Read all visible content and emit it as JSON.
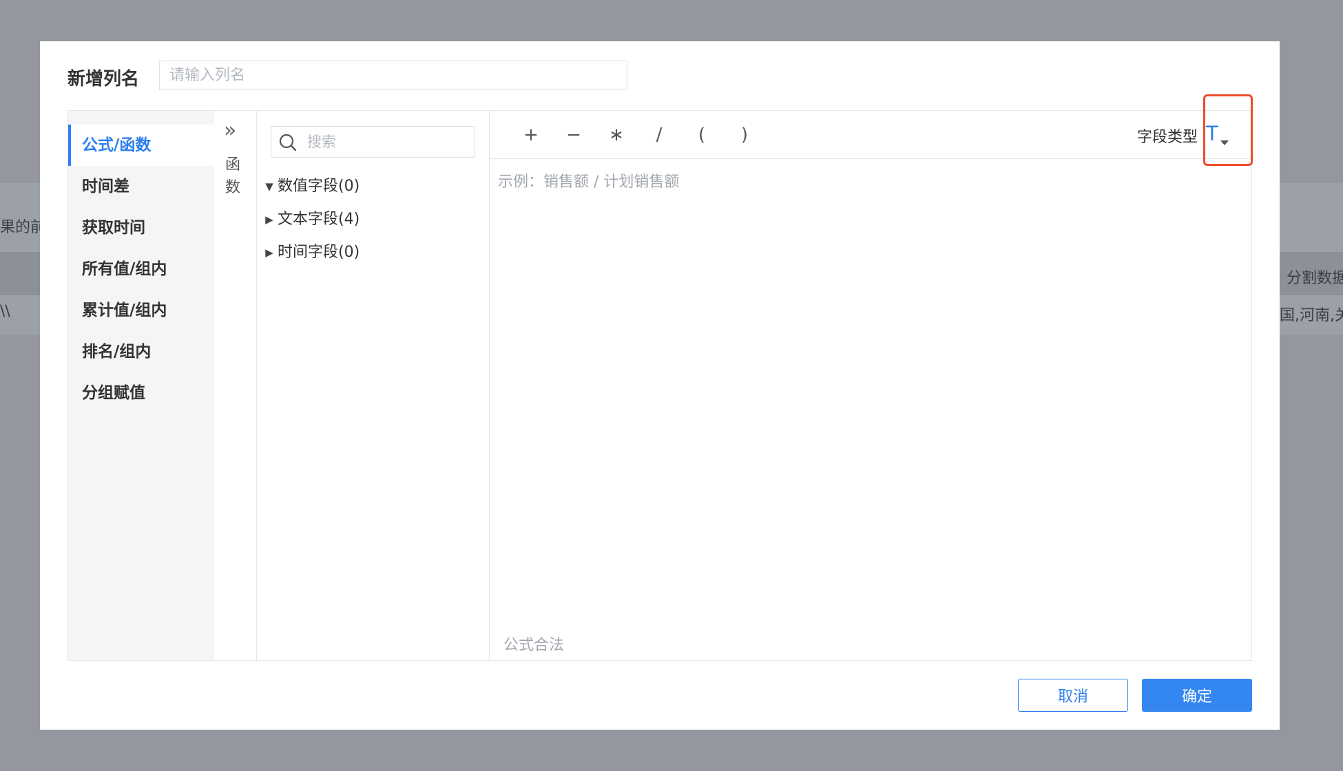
{
  "background": {
    "left_text_top": "果的前",
    "left_text_row": "\\\\",
    "right_text_top": "分割数据",
    "right_text_row": "国,河南,关"
  },
  "dialog": {
    "title": "新增列名",
    "name_placeholder": "请输入列名"
  },
  "categories": [
    {
      "label": "公式/函数",
      "active": true
    },
    {
      "label": "时间差"
    },
    {
      "label": "获取时间"
    },
    {
      "label": "所有值/组内"
    },
    {
      "label": "累计值/组内"
    },
    {
      "label": "排名/组内"
    },
    {
      "label": "分组赋值"
    }
  ],
  "function_panel": {
    "toggle_icon": "double-chevron-right-icon",
    "label": "函数"
  },
  "fields": {
    "search_placeholder": "搜索",
    "tree": [
      {
        "label": "数值字段(0)",
        "expanded": true
      },
      {
        "label": "文本字段(4)",
        "expanded": false
      },
      {
        "label": "时间字段(0)",
        "expanded": false
      }
    ]
  },
  "formula": {
    "operators": [
      "+",
      "−",
      "∗",
      "/",
      "(",
      ")"
    ],
    "field_type_label": "字段类型",
    "field_type_value": "T",
    "placeholder": "示例：销售额 / 计划销售额",
    "status": "公式合法"
  },
  "footer": {
    "cancel_label": "取消",
    "ok_label": "确定"
  },
  "colors": {
    "accent": "#2f7ff0",
    "highlight": "#f04a2c"
  }
}
